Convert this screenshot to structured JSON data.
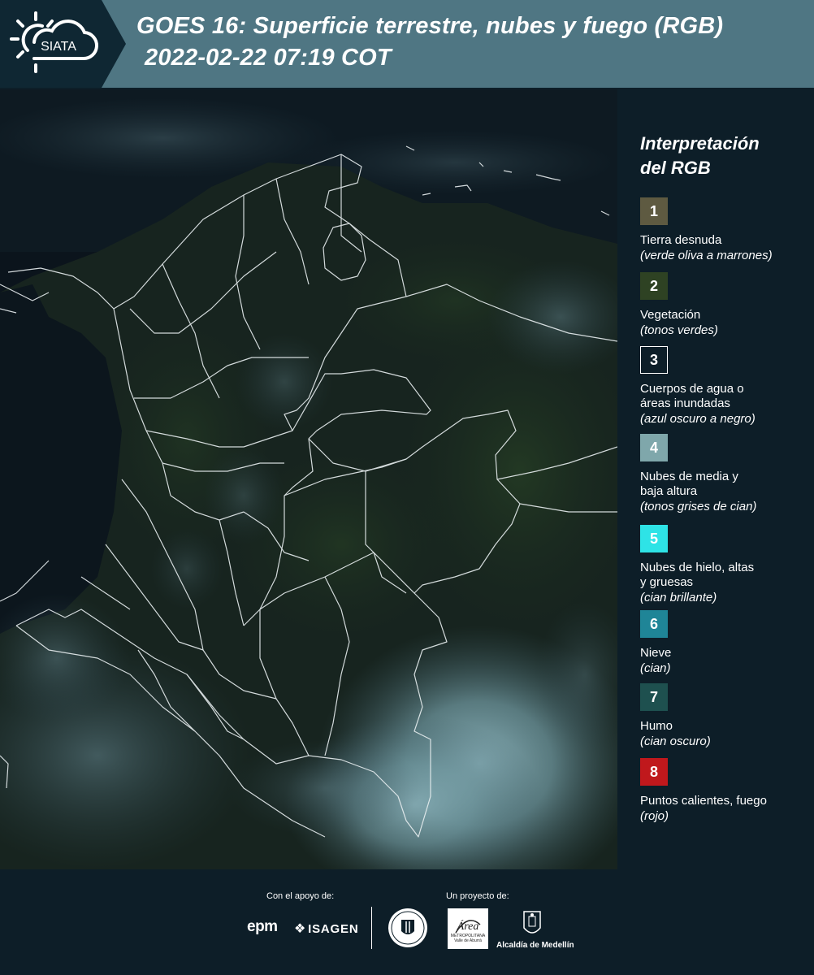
{
  "header": {
    "logo_text": "SIATA",
    "title_line1": "GOES 16: Superficie terrestre, nubes y fuego (RGB)",
    "title_line2": "2022-02-22 07:19 COT"
  },
  "map": {
    "content": "satellite-rgb-composite",
    "icon": "colombia-boundaries-map"
  },
  "legend": {
    "title_line1": "Interpretación",
    "title_line2": "del RGB",
    "items": [
      {
        "num": "1",
        "color": "#5e5a41",
        "border": "#5e5a41",
        "label": "Tierra desnuda",
        "sub": "(verde oliva a marrones)"
      },
      {
        "num": "2",
        "color": "#2e4223",
        "border": "#2e4223",
        "label": "Vegetación",
        "sub": "(tonos verdes)"
      },
      {
        "num": "3",
        "color": "#0d1e28",
        "border": "#ffffff",
        "label": "Cuerpos de agua o áreas inundadas",
        "sub": "(azul oscuro a negro)"
      },
      {
        "num": "4",
        "color": "#7fa7ab",
        "border": "#7fa7ab",
        "label": "Nubes de media y baja altura",
        "sub": "(tonos grises de cian)"
      },
      {
        "num": "5",
        "color": "#2ee3e6",
        "border": "#2ee3e6",
        "label": "Nubes de hielo, altas y gruesas",
        "sub": "(cian brillante)"
      },
      {
        "num": "6",
        "color": "#1f8597",
        "border": "#1f8597",
        "label": "Nieve",
        "sub": "(cian)"
      },
      {
        "num": "7",
        "color": "#1e504f",
        "border": "#1e504f",
        "label": "Humo",
        "sub": "(cian oscuro)"
      },
      {
        "num": "8",
        "color": "#c0181c",
        "border": "#c0181c",
        "label": "Puntos calientes, fuego",
        "sub": "(rojo)"
      }
    ]
  },
  "footer": {
    "support_label": "Con el apoyo de:",
    "project_label": "Un proyecto de:",
    "epm_logo": "epm",
    "isagen_logo": "ISAGEN",
    "area_logo": "Área",
    "area_subtext": "METROPOLITANA Valle de Aburrá",
    "alcaldia": "Alcaldía de Medellín"
  },
  "colors": {
    "header_bg": "#4f7683",
    "logo_bg": "#0f2733",
    "page_bg": "#0d1e28"
  }
}
